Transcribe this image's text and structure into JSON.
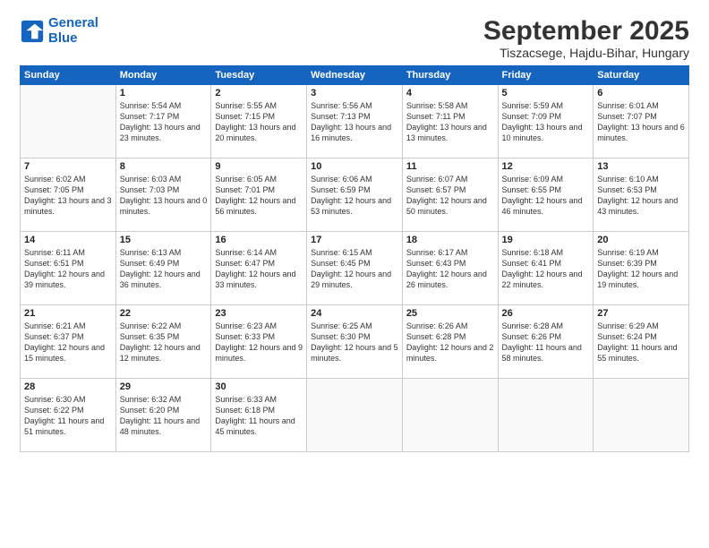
{
  "logo": {
    "line1": "General",
    "line2": "Blue"
  },
  "title": "September 2025",
  "location": "Tiszacsege, Hajdu-Bihar, Hungary",
  "weekdays": [
    "Sunday",
    "Monday",
    "Tuesday",
    "Wednesday",
    "Thursday",
    "Friday",
    "Saturday"
  ],
  "weeks": [
    [
      {
        "day": "",
        "info": ""
      },
      {
        "day": "1",
        "info": "Sunrise: 5:54 AM\nSunset: 7:17 PM\nDaylight: 13 hours\nand 23 minutes."
      },
      {
        "day": "2",
        "info": "Sunrise: 5:55 AM\nSunset: 7:15 PM\nDaylight: 13 hours\nand 20 minutes."
      },
      {
        "day": "3",
        "info": "Sunrise: 5:56 AM\nSunset: 7:13 PM\nDaylight: 13 hours\nand 16 minutes."
      },
      {
        "day": "4",
        "info": "Sunrise: 5:58 AM\nSunset: 7:11 PM\nDaylight: 13 hours\nand 13 minutes."
      },
      {
        "day": "5",
        "info": "Sunrise: 5:59 AM\nSunset: 7:09 PM\nDaylight: 13 hours\nand 10 minutes."
      },
      {
        "day": "6",
        "info": "Sunrise: 6:01 AM\nSunset: 7:07 PM\nDaylight: 13 hours\nand 6 minutes."
      }
    ],
    [
      {
        "day": "7",
        "info": "Sunrise: 6:02 AM\nSunset: 7:05 PM\nDaylight: 13 hours\nand 3 minutes."
      },
      {
        "day": "8",
        "info": "Sunrise: 6:03 AM\nSunset: 7:03 PM\nDaylight: 13 hours\nand 0 minutes."
      },
      {
        "day": "9",
        "info": "Sunrise: 6:05 AM\nSunset: 7:01 PM\nDaylight: 12 hours\nand 56 minutes."
      },
      {
        "day": "10",
        "info": "Sunrise: 6:06 AM\nSunset: 6:59 PM\nDaylight: 12 hours\nand 53 minutes."
      },
      {
        "day": "11",
        "info": "Sunrise: 6:07 AM\nSunset: 6:57 PM\nDaylight: 12 hours\nand 50 minutes."
      },
      {
        "day": "12",
        "info": "Sunrise: 6:09 AM\nSunset: 6:55 PM\nDaylight: 12 hours\nand 46 minutes."
      },
      {
        "day": "13",
        "info": "Sunrise: 6:10 AM\nSunset: 6:53 PM\nDaylight: 12 hours\nand 43 minutes."
      }
    ],
    [
      {
        "day": "14",
        "info": "Sunrise: 6:11 AM\nSunset: 6:51 PM\nDaylight: 12 hours\nand 39 minutes."
      },
      {
        "day": "15",
        "info": "Sunrise: 6:13 AM\nSunset: 6:49 PM\nDaylight: 12 hours\nand 36 minutes."
      },
      {
        "day": "16",
        "info": "Sunrise: 6:14 AM\nSunset: 6:47 PM\nDaylight: 12 hours\nand 33 minutes."
      },
      {
        "day": "17",
        "info": "Sunrise: 6:15 AM\nSunset: 6:45 PM\nDaylight: 12 hours\nand 29 minutes."
      },
      {
        "day": "18",
        "info": "Sunrise: 6:17 AM\nSunset: 6:43 PM\nDaylight: 12 hours\nand 26 minutes."
      },
      {
        "day": "19",
        "info": "Sunrise: 6:18 AM\nSunset: 6:41 PM\nDaylight: 12 hours\nand 22 minutes."
      },
      {
        "day": "20",
        "info": "Sunrise: 6:19 AM\nSunset: 6:39 PM\nDaylight: 12 hours\nand 19 minutes."
      }
    ],
    [
      {
        "day": "21",
        "info": "Sunrise: 6:21 AM\nSunset: 6:37 PM\nDaylight: 12 hours\nand 15 minutes."
      },
      {
        "day": "22",
        "info": "Sunrise: 6:22 AM\nSunset: 6:35 PM\nDaylight: 12 hours\nand 12 minutes."
      },
      {
        "day": "23",
        "info": "Sunrise: 6:23 AM\nSunset: 6:33 PM\nDaylight: 12 hours\nand 9 minutes."
      },
      {
        "day": "24",
        "info": "Sunrise: 6:25 AM\nSunset: 6:30 PM\nDaylight: 12 hours\nand 5 minutes."
      },
      {
        "day": "25",
        "info": "Sunrise: 6:26 AM\nSunset: 6:28 PM\nDaylight: 12 hours\nand 2 minutes."
      },
      {
        "day": "26",
        "info": "Sunrise: 6:28 AM\nSunset: 6:26 PM\nDaylight: 11 hours\nand 58 minutes."
      },
      {
        "day": "27",
        "info": "Sunrise: 6:29 AM\nSunset: 6:24 PM\nDaylight: 11 hours\nand 55 minutes."
      }
    ],
    [
      {
        "day": "28",
        "info": "Sunrise: 6:30 AM\nSunset: 6:22 PM\nDaylight: 11 hours\nand 51 minutes."
      },
      {
        "day": "29",
        "info": "Sunrise: 6:32 AM\nSunset: 6:20 PM\nDaylight: 11 hours\nand 48 minutes."
      },
      {
        "day": "30",
        "info": "Sunrise: 6:33 AM\nSunset: 6:18 PM\nDaylight: 11 hours\nand 45 minutes."
      },
      {
        "day": "",
        "info": ""
      },
      {
        "day": "",
        "info": ""
      },
      {
        "day": "",
        "info": ""
      },
      {
        "day": "",
        "info": ""
      }
    ]
  ]
}
